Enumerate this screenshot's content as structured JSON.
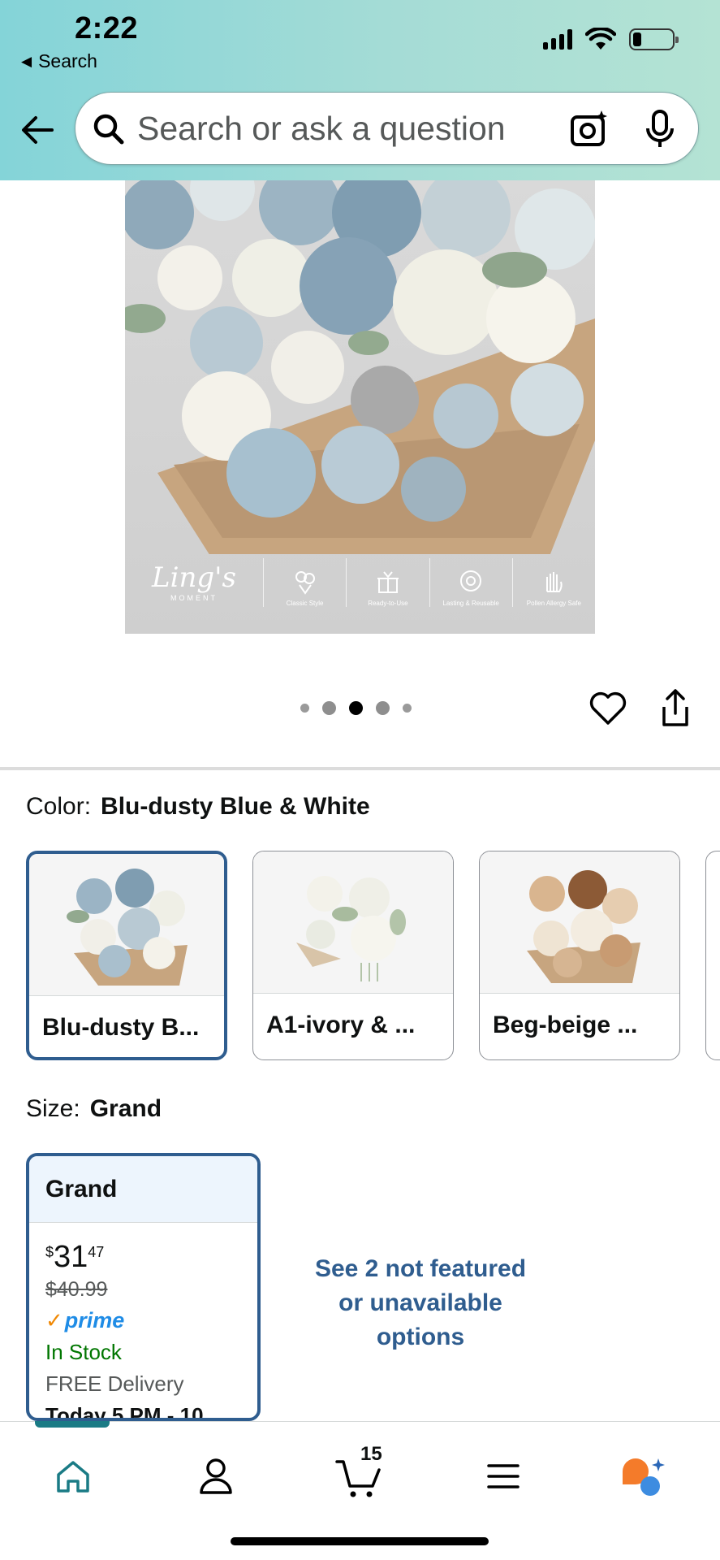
{
  "status_bar": {
    "time": "2:22",
    "back_app_label": "Search"
  },
  "header": {
    "search_placeholder": "Search or ask a question"
  },
  "product_image": {
    "brand": "Ling's",
    "brand_sub": "MOMENT",
    "features": [
      "Classic Style",
      "Ready-to-Use",
      "Lasting & Reusable",
      "Pollen Allergy Safe"
    ],
    "carousel_index": 3,
    "carousel_total": 5
  },
  "color": {
    "label": "Color:",
    "selected": "Blu-dusty Blue & White",
    "options": [
      {
        "label": "Blu-dusty B...",
        "selected": true
      },
      {
        "label": "A1-ivory & ...",
        "selected": false
      },
      {
        "label": "Beg-beige ...",
        "selected": false
      }
    ]
  },
  "size": {
    "label": "Size:",
    "selected": "Grand",
    "option": {
      "name": "Grand",
      "price_symbol": "$",
      "price_whole": "31",
      "price_fraction": "47",
      "list_price": "$40.99",
      "prime_label": "prime",
      "stock": "In Stock",
      "delivery": "FREE Delivery",
      "delivery_date": "Today 5 PM - 10"
    },
    "see_more_line1": "See 2 not featured",
    "see_more_line2": "or unavailable",
    "see_more_line3": "options"
  },
  "bottom_nav": {
    "cart_count": "15",
    "active": "home"
  },
  "colors": {
    "accent_blue": "#2f5d8f",
    "header_teal": "#a5dcd6",
    "stock_green": "#007600",
    "prime_blue": "#1f8ce6"
  }
}
